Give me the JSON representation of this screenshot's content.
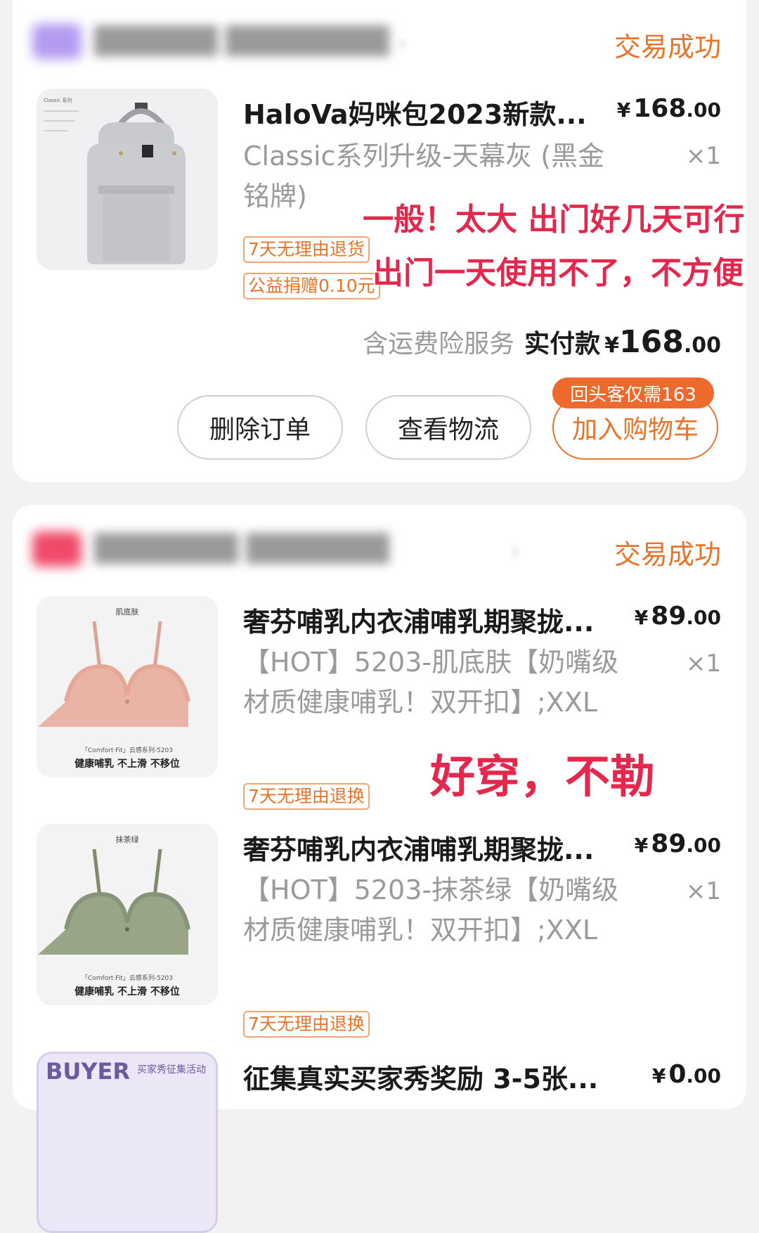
{
  "orders": [
    {
      "status": "交易成功",
      "item": {
        "title": "HaloVa妈咪包2023新款...",
        "price_int": "168",
        "price_dec": ".00",
        "sku": "Classic系列升级-天幕灰 (黑金铭牌)",
        "qty": "×1",
        "tags": [
          "7天无理由退货",
          "公益捐赠0.10元"
        ],
        "thumb_brand_text": "Classic 系列",
        "thumb_icon": "backpack-icon"
      },
      "annotation": [
        "一般！太大 出门好几天可行",
        "出门一天使用不了，不方便"
      ],
      "summary": {
        "note": "含运费险服务",
        "label": "实付款",
        "yen": "¥",
        "int": "168",
        "dec": ".00"
      },
      "buttons": {
        "delete": "删除订单",
        "logistics": "查看物流",
        "cart": "加入购物车",
        "cart_badge": "回头客仅需163"
      }
    },
    {
      "status": "交易成功",
      "items": [
        {
          "title": "奢芬哺乳内衣浦哺乳期聚拢...",
          "price_int": "89",
          "price_dec": ".00",
          "sku": "【HOT】5203-肌底肤【奶嘴级材质健康哺乳！双开扣】;XXL",
          "qty": "×1",
          "tag": "7天无理由退换",
          "thumb_top": "肌底肤",
          "thumb_series": "「Comfort·Fit」云感系列-5203",
          "thumb_slogan": "健康哺乳 不上滑 不移位",
          "color": "#e9b4a6"
        },
        {
          "title": "奢芬哺乳内衣浦哺乳期聚拢...",
          "price_int": "89",
          "price_dec": ".00",
          "sku": "【HOT】5203-抹茶绿【奶嘴级材质健康哺乳！双开扣】;XXL",
          "qty": "×1",
          "tag": "7天无理由退换",
          "thumb_top": "抹茶绿",
          "thumb_series": "「Comfort·Fit」云感系列-5203",
          "thumb_slogan": "健康哺乳 不上滑 不移位",
          "color": "#98a586"
        },
        {
          "title": "征集真实买家秀奖励 3-5张...",
          "price_int": "0",
          "price_dec": ".00",
          "thumb_top": "BUYER",
          "thumb_sub": "买家秀征集活动"
        }
      ],
      "annotation": "好穿，不勒"
    }
  ],
  "currency": "¥",
  "colors": {
    "accent": "#e8742a",
    "annotation": "#e4284d",
    "background": "#f2f2f2"
  }
}
